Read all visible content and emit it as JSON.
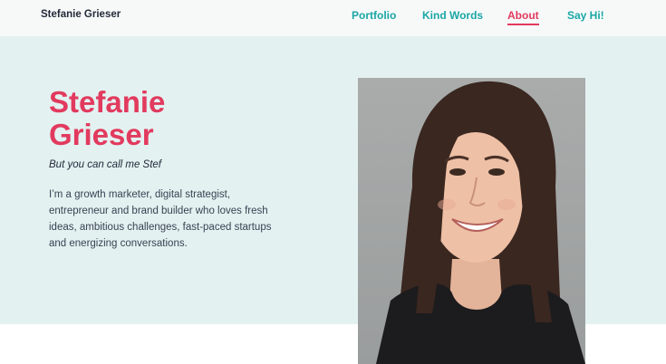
{
  "header": {
    "brand": "Stefanie Grieser",
    "nav": [
      {
        "label": "Portfolio",
        "active": false
      },
      {
        "label": "Kind Words",
        "active": false
      },
      {
        "label": "About",
        "active": true
      },
      {
        "label": "Say Hi!",
        "active": false
      }
    ]
  },
  "hero": {
    "title_line1": "Stefanie",
    "title_line2": "Grieser",
    "subtitle": "But you can call me Stef",
    "bio": "I’m a growth marketer, digital strategist, entrepreneur and brand builder who loves fresh ideas, ambitious challenges, fast-paced startups and energizing conversations."
  },
  "colors": {
    "accent": "#e23a5e",
    "nav_link": "#1aa6a6",
    "hero_background": "#e3f1f1",
    "text_dark": "#222a3a"
  }
}
